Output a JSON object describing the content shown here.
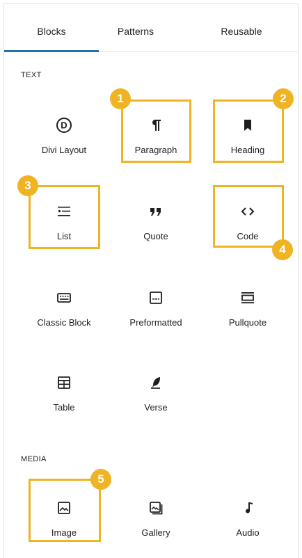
{
  "tabs": [
    {
      "label": "Blocks",
      "active": true
    },
    {
      "label": "Patterns",
      "active": false
    },
    {
      "label": "Reusable",
      "active": false
    }
  ],
  "categories": {
    "text": "TEXT",
    "media": "MEDIA"
  },
  "blocks": {
    "divi_layout": {
      "label": "Divi Layout",
      "icon": "divi-icon"
    },
    "paragraph": {
      "label": "Paragraph",
      "icon": "paragraph-icon"
    },
    "heading": {
      "label": "Heading",
      "icon": "heading-icon"
    },
    "list": {
      "label": "List",
      "icon": "list-icon"
    },
    "quote": {
      "label": "Quote",
      "icon": "quote-icon"
    },
    "code": {
      "label": "Code",
      "icon": "code-icon"
    },
    "classic": {
      "label": "Classic Block",
      "icon": "keyboard-icon"
    },
    "preformatted": {
      "label": "Preformatted",
      "icon": "preformatted-icon"
    },
    "pullquote": {
      "label": "Pullquote",
      "icon": "pullquote-icon"
    },
    "table": {
      "label": "Table",
      "icon": "table-icon"
    },
    "verse": {
      "label": "Verse",
      "icon": "feather-icon"
    },
    "image": {
      "label": "Image",
      "icon": "image-icon"
    },
    "gallery": {
      "label": "Gallery",
      "icon": "gallery-icon"
    },
    "audio": {
      "label": "Audio",
      "icon": "music-note-icon"
    }
  },
  "annotations": [
    "1",
    "2",
    "3",
    "4",
    "5"
  ],
  "colors": {
    "accent": "#2271b1",
    "highlight": "#f0b323",
    "text": "#1e1e1e"
  }
}
